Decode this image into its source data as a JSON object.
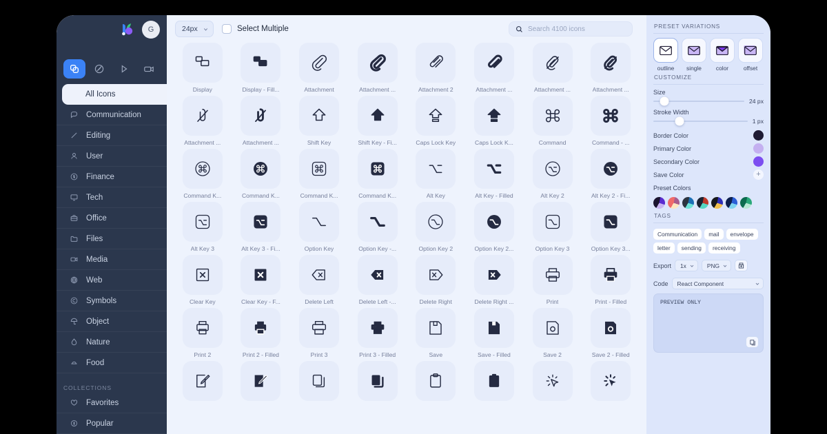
{
  "sidebar": {
    "brand_logo_name": "app-logo",
    "avatar_initial": "G",
    "mode_tabs": [
      {
        "name": "icons-mode-tab",
        "icon": "shapes-icon",
        "active": true
      },
      {
        "name": "illustrations-mode-tab",
        "icon": "illustration-icon",
        "active": false
      },
      {
        "name": "animations-mode-tab",
        "icon": "play-icon",
        "active": false
      },
      {
        "name": "video-mode-tab",
        "icon": "video-camera-icon",
        "active": false
      }
    ],
    "items": [
      {
        "label": "All Icons",
        "icon": "grid-icon",
        "selected": true
      },
      {
        "label": "Communication",
        "icon": "chat-bubble-icon",
        "selected": false
      },
      {
        "label": "Editing",
        "icon": "pencil-icon",
        "selected": false
      },
      {
        "label": "User",
        "icon": "user-icon",
        "selected": false
      },
      {
        "label": "Finance",
        "icon": "dollar-circle-icon",
        "selected": false
      },
      {
        "label": "Tech",
        "icon": "monitor-icon",
        "selected": false
      },
      {
        "label": "Office",
        "icon": "briefcase-icon",
        "selected": false
      },
      {
        "label": "Files",
        "icon": "folder-icon",
        "selected": false
      },
      {
        "label": "Media",
        "icon": "video-icon",
        "selected": false
      },
      {
        "label": "Web",
        "icon": "globe-icon",
        "selected": false
      },
      {
        "label": "Symbols",
        "icon": "copyright-icon",
        "selected": false
      },
      {
        "label": "Object",
        "icon": "umbrella-icon",
        "selected": false
      },
      {
        "label": "Nature",
        "icon": "droplet-icon",
        "selected": false
      },
      {
        "label": "Food",
        "icon": "food-icon",
        "selected": false
      }
    ],
    "collections_heading": "COLLECTIONS",
    "collections": [
      {
        "label": "Favorites",
        "icon": "heart-icon"
      },
      {
        "label": "Popular",
        "icon": "fire-icon"
      }
    ]
  },
  "toolbar": {
    "size_value": "24px",
    "select_multiple_label": "Select Multiple",
    "select_multiple_checked": false,
    "search_placeholder": "Search 4100 icons",
    "search_value": ""
  },
  "grid": {
    "icons": [
      {
        "label": "Display",
        "glyph": "display"
      },
      {
        "label": "Display - Fill...",
        "glyph": "display-filled"
      },
      {
        "label": "Attachment",
        "glyph": "paperclip"
      },
      {
        "label": "Attachment ...",
        "glyph": "paperclip-filled"
      },
      {
        "label": "Attachment 2",
        "glyph": "paperclip2"
      },
      {
        "label": "Attachment ...",
        "glyph": "paperclip2-filled"
      },
      {
        "label": "Attachment ...",
        "glyph": "paperclip-off"
      },
      {
        "label": "Attachment ...",
        "glyph": "paperclip-off-filled"
      },
      {
        "label": "Attachment ...",
        "glyph": "paperclip-slash"
      },
      {
        "label": "Attachment ...",
        "glyph": "paperclip-slash-filled"
      },
      {
        "label": "Shift Key",
        "glyph": "shift"
      },
      {
        "label": "Shift Key - Fi...",
        "glyph": "shift-filled"
      },
      {
        "label": "Caps Lock Key",
        "glyph": "capslock"
      },
      {
        "label": "Caps Lock K...",
        "glyph": "capslock-filled"
      },
      {
        "label": "Command",
        "glyph": "command"
      },
      {
        "label": "Command - ...",
        "glyph": "command-filled"
      },
      {
        "label": "Command K...",
        "glyph": "command-circle"
      },
      {
        "label": "Command K...",
        "glyph": "command-circle-filled"
      },
      {
        "label": "Command K...",
        "glyph": "command-square"
      },
      {
        "label": "Command K...",
        "glyph": "command-square-filled"
      },
      {
        "label": "Alt Key",
        "glyph": "alt"
      },
      {
        "label": "Alt Key - Filled",
        "glyph": "alt-filled"
      },
      {
        "label": "Alt Key 2",
        "glyph": "alt-circle"
      },
      {
        "label": "Alt Key 2 - Fi...",
        "glyph": "alt-circle-filled"
      },
      {
        "label": "Alt Key 3",
        "glyph": "alt-square"
      },
      {
        "label": "Alt Key 3 - Fi...",
        "glyph": "alt-square-filled"
      },
      {
        "label": "Option Key",
        "glyph": "option"
      },
      {
        "label": "Option Key -...",
        "glyph": "option-filled"
      },
      {
        "label": "Option Key 2",
        "glyph": "option-circle"
      },
      {
        "label": "Option Key 2...",
        "glyph": "option-circle-filled"
      },
      {
        "label": "Option Key 3",
        "glyph": "option-square"
      },
      {
        "label": "Option Key 3...",
        "glyph": "option-square-filled"
      },
      {
        "label": "Clear Key",
        "glyph": "clear"
      },
      {
        "label": "Clear Key - F...",
        "glyph": "clear-filled"
      },
      {
        "label": "Delete Left",
        "glyph": "delete-left"
      },
      {
        "label": "Delete Left -...",
        "glyph": "delete-left-filled"
      },
      {
        "label": "Delete Right",
        "glyph": "delete-right"
      },
      {
        "label": "Delete Right ...",
        "glyph": "delete-right-filled"
      },
      {
        "label": "Print",
        "glyph": "print"
      },
      {
        "label": "Print - Filled",
        "glyph": "print-filled"
      },
      {
        "label": "Print 2",
        "glyph": "print2"
      },
      {
        "label": "Print 2 - Filled",
        "glyph": "print2-filled"
      },
      {
        "label": "Print 3",
        "glyph": "print3"
      },
      {
        "label": "Print 3 - Filled",
        "glyph": "print3-filled"
      },
      {
        "label": "Save",
        "glyph": "save"
      },
      {
        "label": "Save - Filled",
        "glyph": "save-filled"
      },
      {
        "label": "Save 2",
        "glyph": "save2"
      },
      {
        "label": "Save 2 - Filled",
        "glyph": "save2-filled"
      },
      {
        "label": "",
        "glyph": "edit-square"
      },
      {
        "label": "",
        "glyph": "edit-square-filled"
      },
      {
        "label": "",
        "glyph": "copy"
      },
      {
        "label": "",
        "glyph": "copy-filled"
      },
      {
        "label": "",
        "glyph": "clipboard"
      },
      {
        "label": "",
        "glyph": "clipboard-filled"
      },
      {
        "label": "",
        "glyph": "click"
      },
      {
        "label": "",
        "glyph": "click-filled"
      }
    ]
  },
  "panel": {
    "preset_variations_heading": "PRESET VARIATIONS",
    "presets": [
      {
        "label": "outline",
        "style": "outline",
        "active": true
      },
      {
        "label": "single",
        "style": "single",
        "active": false
      },
      {
        "label": "color",
        "style": "color",
        "active": false
      },
      {
        "label": "offset",
        "style": "offset",
        "active": false
      }
    ],
    "customize_heading": "CUSTOMIZE",
    "size": {
      "label": "Size",
      "value": "24 px",
      "percent": 12
    },
    "stroke_width": {
      "label": "Stroke Width",
      "value": "1 px",
      "percent": 28
    },
    "colors": [
      {
        "label": "Border Color",
        "hex": "#1f1b33"
      },
      {
        "label": "Primary Color",
        "hex": "#c4b0f0"
      },
      {
        "label": "Secondary Color",
        "hex": "#7c4ef0"
      }
    ],
    "save_color_label": "Save Color",
    "preset_colors_label": "Preset Colors",
    "preset_colors": [
      [
        "#1b1430",
        "#5a2bd0",
        "#c9b5f2"
      ],
      [
        "#f06a6a",
        "#a85c8e",
        "#fde6c0"
      ],
      [
        "#2c3440",
        "#1c6fb5",
        "#6fe3d9"
      ],
      [
        "#1b2333",
        "#c0392b",
        "#55d6c2"
      ],
      [
        "#16181c",
        "#2f2fb5",
        "#f2c14e"
      ],
      [
        "#0d1f4d",
        "#2b5ed6",
        "#7fd3f0"
      ],
      [
        "#0c6b4f",
        "#2aa87a",
        "#b7e8d4"
      ]
    ],
    "tags_heading": "TAGS",
    "tags": [
      "Communication",
      "mail",
      "envelope",
      "letter",
      "sending",
      "receiving"
    ],
    "export_label": "Export",
    "export_scale": "1x",
    "export_format": "PNG",
    "download_icon": "download-icon",
    "code_label": "Code",
    "code_format": "React Component",
    "code_preview": "PREVIEW ONLY",
    "copy_icon": "copy-icon"
  }
}
